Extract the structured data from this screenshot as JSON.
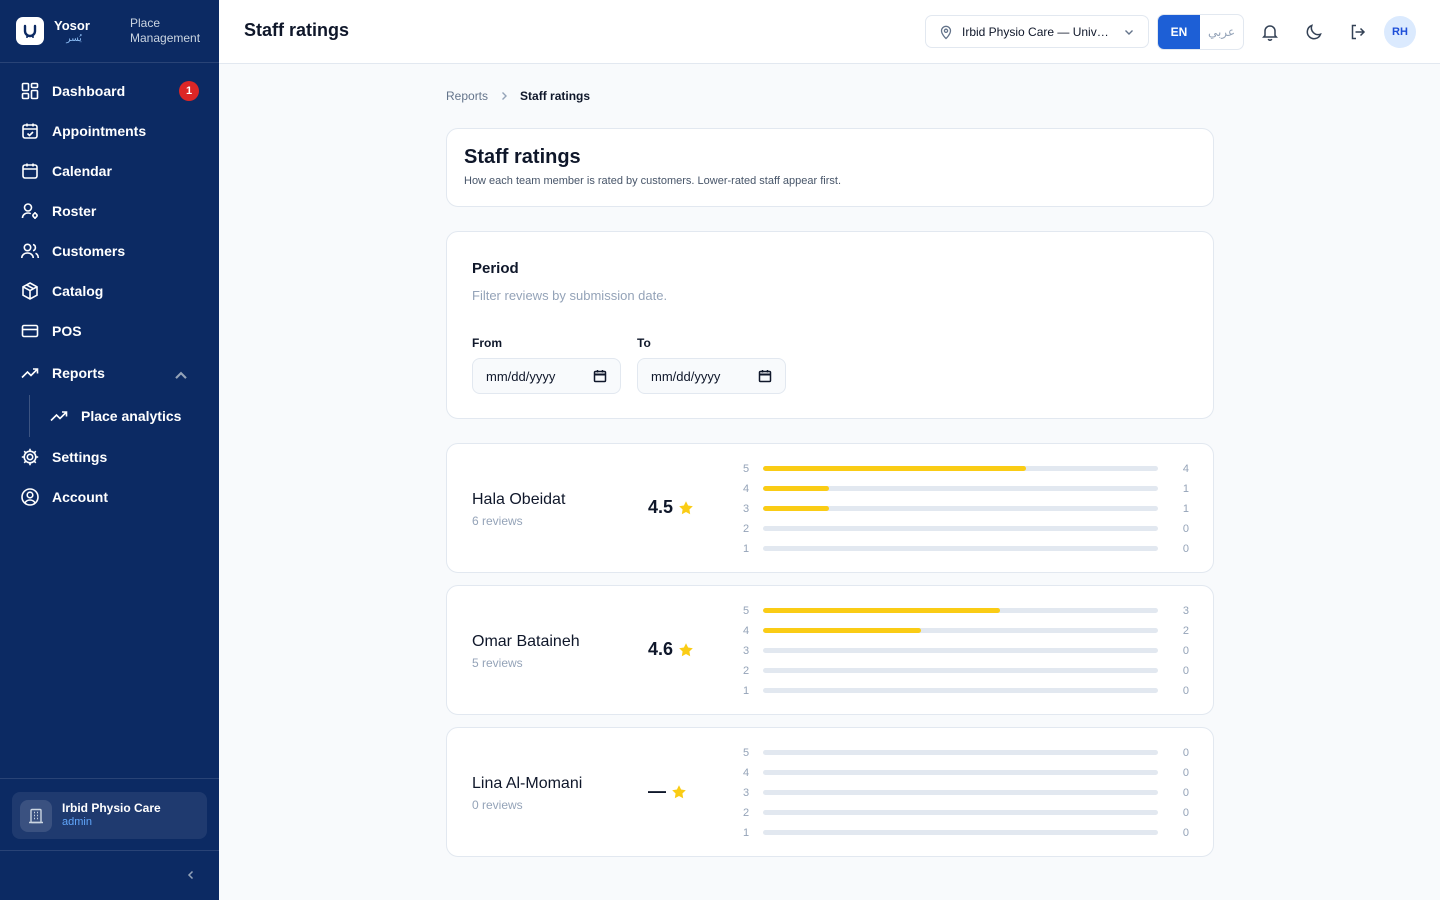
{
  "brand": {
    "name": "Yosor",
    "sub": "يُسر",
    "place_line1": "Place",
    "place_line2": "Management"
  },
  "nav": {
    "dashboard": "Dashboard",
    "dashboard_badge": "1",
    "appointments": "Appointments",
    "calendar": "Calendar",
    "roster": "Roster",
    "customers": "Customers",
    "catalog": "Catalog",
    "pos": "POS",
    "reports": "Reports",
    "place_analytics": "Place analytics",
    "settings": "Settings",
    "account": "Account"
  },
  "org": {
    "name": "Irbid Physio Care",
    "role": "admin"
  },
  "header": {
    "title": "Staff ratings",
    "location": "Irbid Physio Care — University Street",
    "lang_en": "EN",
    "lang_ar": "عربي",
    "avatar": "RH"
  },
  "breadcrumb": {
    "parent": "Reports",
    "current": "Staff ratings"
  },
  "page": {
    "title": "Staff ratings",
    "subtitle": "How each team member is rated by customers. Lower-rated staff appear first."
  },
  "period": {
    "title": "Period",
    "subtitle": "Filter reviews by submission date.",
    "from_label": "From",
    "to_label": "To",
    "from_placeholder": "mm/dd/yyyy",
    "to_placeholder": "mm/dd/yyyy"
  },
  "colors": {
    "sidebar": "#0c2a63",
    "accent": "#1d5fd6",
    "star": "#facc15",
    "badge": "#dc2626"
  },
  "staff": [
    {
      "name": "Hala Obeidat",
      "reviews": "6 reviews",
      "score": "4.5",
      "total": 6,
      "distribution": [
        {
          "stars": "5",
          "count": 4
        },
        {
          "stars": "4",
          "count": 1
        },
        {
          "stars": "3",
          "count": 1
        },
        {
          "stars": "2",
          "count": 0
        },
        {
          "stars": "1",
          "count": 0
        }
      ]
    },
    {
      "name": "Omar Bataineh",
      "reviews": "5 reviews",
      "score": "4.6",
      "total": 5,
      "distribution": [
        {
          "stars": "5",
          "count": 3
        },
        {
          "stars": "4",
          "count": 2
        },
        {
          "stars": "3",
          "count": 0
        },
        {
          "stars": "2",
          "count": 0
        },
        {
          "stars": "1",
          "count": 0
        }
      ]
    },
    {
      "name": "Lina Al-Momani",
      "reviews": "0 reviews",
      "score": "—",
      "total": 0,
      "distribution": [
        {
          "stars": "5",
          "count": 0
        },
        {
          "stars": "4",
          "count": 0
        },
        {
          "stars": "3",
          "count": 0
        },
        {
          "stars": "2",
          "count": 0
        },
        {
          "stars": "1",
          "count": 0
        }
      ]
    }
  ]
}
